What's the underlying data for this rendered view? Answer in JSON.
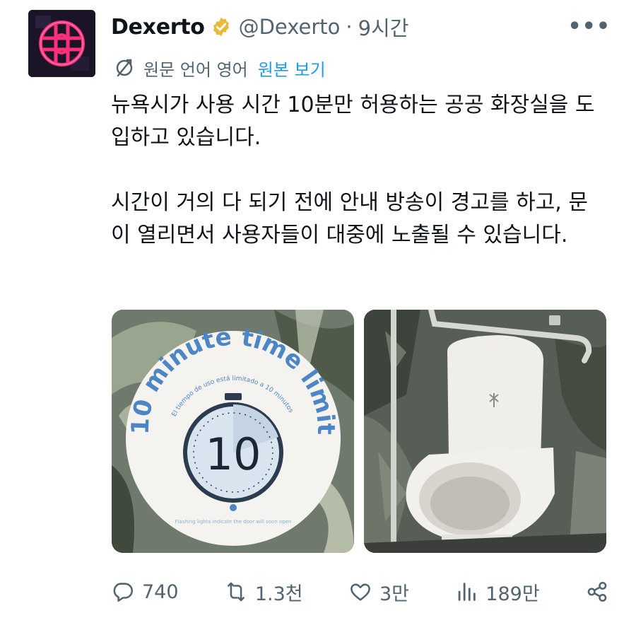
{
  "tweet": {
    "author_name": "Dexerto",
    "handle": "@Dexerto",
    "separator": "·",
    "time": "9시간",
    "more": "•••",
    "translation_note": "원문 언어 영어",
    "show_original": "원본 보기",
    "paragraphs": [
      "뉴욕시가 사용 시간 10분만 허용하는 공공 화장실을 도입하고 있습니다.",
      "시간이 거의 다 되기 전에 안내 방송이 경고를 하고, 문이 열리면서 사용자들이 대중에 노출될 수 있습니다."
    ]
  },
  "media": {
    "sign": {
      "arc_text": "10 minute time limit",
      "spanish_text": "El tiempo de uso está limitado a 10 minutos",
      "timer_number": "10",
      "footer_text": "Flashing lights indicate the door will soon open"
    }
  },
  "actions": {
    "replies": "740",
    "reposts": "1.3천",
    "likes": "3만",
    "views": "189만"
  },
  "colors": {
    "accent": "#1d9bf0",
    "muted": "#536471",
    "text": "#0f1419",
    "verified_gold": "#e8b93b",
    "logo_neon": "#ff2f7a"
  },
  "icons": [
    "dexerto-logo-icon",
    "verified-badge-icon",
    "more-icon",
    "translate-icon",
    "reply-icon",
    "repost-icon",
    "like-icon",
    "views-icon",
    "share-icon"
  ]
}
